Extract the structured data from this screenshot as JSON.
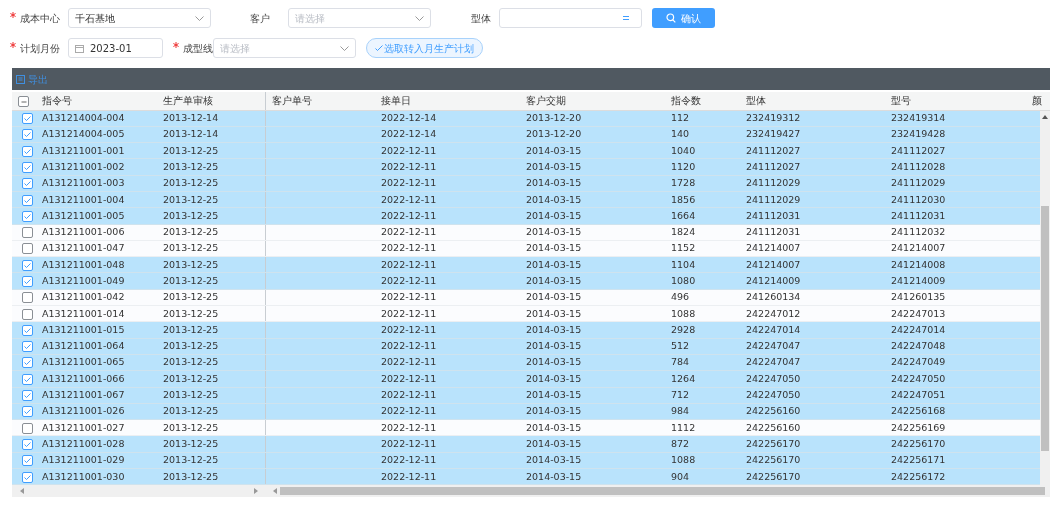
{
  "filters": [
    {
      "kind": "select",
      "label": "成本中心",
      "required": true,
      "value": "千石基地"
    },
    {
      "kind": "select",
      "label": "客户",
      "required": false,
      "placeholder": "请选择"
    },
    {
      "kind": "text",
      "label": "型体",
      "required": false
    },
    {
      "kind": "button",
      "label": "确认"
    },
    {
      "kind": "date",
      "label": "计划月份",
      "required": true,
      "value": "2023-01"
    },
    {
      "kind": "select",
      "label": "成型线",
      "required": true,
      "placeholder": "请选择"
    },
    {
      "kind": "pill",
      "label": "选取转入月生产计划"
    }
  ],
  "toolbar": {
    "export_label": "导出"
  },
  "table": {
    "select_all": {
      "indeterminate": true
    },
    "columns": [
      "指令号",
      "生产单审核",
      "客户单号",
      "接单日",
      "客户交期",
      "指令数",
      "型体",
      "型号",
      "颜"
    ],
    "rows": [
      {
        "checked": true,
        "cells": [
          "A131214004-004",
          "2013-12-14",
          "",
          "2022-12-14",
          "2013-12-20",
          "112",
          "232419312",
          "232419314"
        ]
      },
      {
        "checked": true,
        "cells": [
          "A131214004-005",
          "2013-12-14",
          "",
          "2022-12-14",
          "2013-12-20",
          "140",
          "232419427",
          "232419428"
        ]
      },
      {
        "checked": true,
        "cells": [
          "A131211001-001",
          "2013-12-25",
          "",
          "2022-12-11",
          "2014-03-15",
          "1040",
          "241112027",
          "241112027"
        ]
      },
      {
        "checked": true,
        "cells": [
          "A131211001-002",
          "2013-12-25",
          "",
          "2022-12-11",
          "2014-03-15",
          "1120",
          "241112027",
          "241112028"
        ]
      },
      {
        "checked": true,
        "cells": [
          "A131211001-003",
          "2013-12-25",
          "",
          "2022-12-11",
          "2014-03-15",
          "1728",
          "241112029",
          "241112029"
        ]
      },
      {
        "checked": true,
        "cells": [
          "A131211001-004",
          "2013-12-25",
          "",
          "2022-12-11",
          "2014-03-15",
          "1856",
          "241112029",
          "241112030"
        ]
      },
      {
        "checked": true,
        "cells": [
          "A131211001-005",
          "2013-12-25",
          "",
          "2022-12-11",
          "2014-03-15",
          "1664",
          "241112031",
          "241112031"
        ]
      },
      {
        "checked": false,
        "cells": [
          "A131211001-006",
          "2013-12-25",
          "",
          "2022-12-11",
          "2014-03-15",
          "1824",
          "241112031",
          "241112032"
        ]
      },
      {
        "checked": false,
        "cells": [
          "A131211001-047",
          "2013-12-25",
          "",
          "2022-12-11",
          "2014-03-15",
          "1152",
          "241214007",
          "241214007"
        ]
      },
      {
        "checked": true,
        "cells": [
          "A131211001-048",
          "2013-12-25",
          "",
          "2022-12-11",
          "2014-03-15",
          "1104",
          "241214007",
          "241214008"
        ]
      },
      {
        "checked": true,
        "cells": [
          "A131211001-049",
          "2013-12-25",
          "",
          "2022-12-11",
          "2014-03-15",
          "1080",
          "241214009",
          "241214009"
        ]
      },
      {
        "checked": false,
        "cells": [
          "A131211001-042",
          "2013-12-25",
          "",
          "2022-12-11",
          "2014-03-15",
          "496",
          "241260134",
          "241260135"
        ]
      },
      {
        "checked": false,
        "cells": [
          "A131211001-014",
          "2013-12-25",
          "",
          "2022-12-11",
          "2014-03-15",
          "1088",
          "242247012",
          "242247013"
        ]
      },
      {
        "checked": true,
        "cells": [
          "A131211001-015",
          "2013-12-25",
          "",
          "2022-12-11",
          "2014-03-15",
          "2928",
          "242247014",
          "242247014"
        ]
      },
      {
        "checked": true,
        "cells": [
          "A131211001-064",
          "2013-12-25",
          "",
          "2022-12-11",
          "2014-03-15",
          "512",
          "242247047",
          "242247048"
        ]
      },
      {
        "checked": true,
        "cells": [
          "A131211001-065",
          "2013-12-25",
          "",
          "2022-12-11",
          "2014-03-15",
          "784",
          "242247047",
          "242247049"
        ]
      },
      {
        "checked": true,
        "cells": [
          "A131211001-066",
          "2013-12-25",
          "",
          "2022-12-11",
          "2014-03-15",
          "1264",
          "242247050",
          "242247050"
        ]
      },
      {
        "checked": true,
        "cells": [
          "A131211001-067",
          "2013-12-25",
          "",
          "2022-12-11",
          "2014-03-15",
          "712",
          "242247050",
          "242247051"
        ]
      },
      {
        "checked": true,
        "cells": [
          "A131211001-026",
          "2013-12-25",
          "",
          "2022-12-11",
          "2014-03-15",
          "984",
          "242256160",
          "242256168"
        ]
      },
      {
        "checked": false,
        "cells": [
          "A131211001-027",
          "2013-12-25",
          "",
          "2022-12-11",
          "2014-03-15",
          "1112",
          "242256160",
          "242256169"
        ]
      },
      {
        "checked": true,
        "cells": [
          "A131211001-028",
          "2013-12-25",
          "",
          "2022-12-11",
          "2014-03-15",
          "872",
          "242256170",
          "242256170"
        ]
      },
      {
        "checked": true,
        "cells": [
          "A131211001-029",
          "2013-12-25",
          "",
          "2022-12-11",
          "2014-03-15",
          "1088",
          "242256170",
          "242256171"
        ]
      },
      {
        "checked": true,
        "cells": [
          "A131211001-030",
          "2013-12-25",
          "",
          "2022-12-11",
          "2014-03-15",
          "904",
          "242256170",
          "242256172"
        ]
      }
    ]
  }
}
